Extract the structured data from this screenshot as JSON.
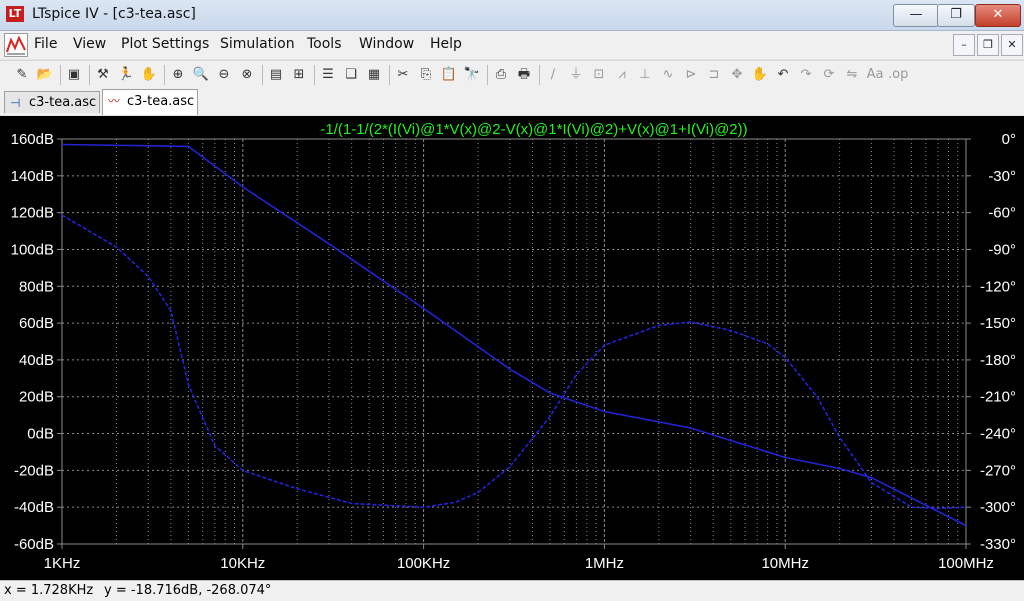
{
  "window": {
    "title": "LTspice IV - [c3-tea.asc]",
    "app_icon_glyph": "LT",
    "buttons": {
      "minimize": "—",
      "restore": "❐",
      "close": "✕"
    }
  },
  "menu": [
    "File",
    "View",
    "Plot Settings",
    "Simulation",
    "Tools",
    "Window",
    "Help"
  ],
  "mdi_buttons": {
    "minimize": "–",
    "restore": "❐",
    "close": "✕"
  },
  "toolbar": [
    {
      "icon": "new-schematic-icon",
      "glyph": "✎",
      "enabled": true
    },
    {
      "icon": "open-icon",
      "glyph": "📂",
      "enabled": true
    },
    {
      "sep": true
    },
    {
      "icon": "save-icon",
      "glyph": "▣",
      "enabled": true
    },
    {
      "sep": true
    },
    {
      "icon": "control-panel-icon",
      "glyph": "⚒",
      "enabled": true
    },
    {
      "icon": "run-icon",
      "glyph": "🏃",
      "enabled": true
    },
    {
      "icon": "pan-icon",
      "glyph": "✋",
      "enabled": false
    },
    {
      "sep": true
    },
    {
      "icon": "zoom-in-icon",
      "glyph": "⊕",
      "enabled": true
    },
    {
      "icon": "zoom-pan-icon",
      "glyph": "🔍",
      "enabled": true
    },
    {
      "icon": "zoom-out-icon",
      "glyph": "⊖",
      "enabled": true
    },
    {
      "icon": "zoom-fit-icon",
      "glyph": "⊗",
      "enabled": true
    },
    {
      "sep": true
    },
    {
      "icon": "autorange-icon",
      "glyph": "▤",
      "enabled": true
    },
    {
      "icon": "fit-icon",
      "glyph": "⊞",
      "enabled": true
    },
    {
      "sep": true
    },
    {
      "icon": "tile-horizontal-icon",
      "glyph": "☰",
      "enabled": true
    },
    {
      "icon": "cascade-icon",
      "glyph": "❏",
      "enabled": true
    },
    {
      "icon": "tile-vertical-icon",
      "glyph": "▦",
      "enabled": true
    },
    {
      "sep": true
    },
    {
      "icon": "cut-icon",
      "glyph": "✂",
      "enabled": true
    },
    {
      "icon": "copy-icon",
      "glyph": "⎘",
      "enabled": true
    },
    {
      "icon": "paste-icon",
      "glyph": "📋",
      "enabled": true
    },
    {
      "icon": "find-icon",
      "glyph": "🔭",
      "enabled": true
    },
    {
      "sep": true
    },
    {
      "icon": "print-preview-icon",
      "glyph": "⎙",
      "enabled": true
    },
    {
      "icon": "print-icon",
      "glyph": "🖶",
      "enabled": true
    },
    {
      "sep": true
    },
    {
      "icon": "wire-icon",
      "glyph": "∕",
      "enabled": false
    },
    {
      "icon": "ground-icon",
      "glyph": "⏚",
      "enabled": false
    },
    {
      "icon": "label-net-icon",
      "glyph": "⊡",
      "enabled": false
    },
    {
      "icon": "resistor-icon",
      "glyph": "⩘",
      "enabled": false
    },
    {
      "icon": "capacitor-icon",
      "glyph": "⊥",
      "enabled": false
    },
    {
      "icon": "inductor-icon",
      "glyph": "∿",
      "enabled": false
    },
    {
      "icon": "diode-icon",
      "glyph": "⊳",
      "enabled": false
    },
    {
      "icon": "component-icon",
      "glyph": "⊐",
      "enabled": false
    },
    {
      "icon": "move-icon",
      "glyph": "✥",
      "enabled": false
    },
    {
      "icon": "drag-icon",
      "glyph": "✋",
      "enabled": false
    },
    {
      "icon": "undo-icon",
      "glyph": "↶",
      "enabled": true
    },
    {
      "icon": "redo-icon",
      "glyph": "↷",
      "enabled": false
    },
    {
      "icon": "rotate-icon",
      "glyph": "⟳",
      "enabled": false
    },
    {
      "icon": "mirror-icon",
      "glyph": "⇋",
      "enabled": false
    },
    {
      "icon": "text-icon",
      "glyph": "Aa",
      "enabled": false
    },
    {
      "icon": "spice-directive-icon",
      "glyph": ".op",
      "enabled": false
    }
  ],
  "tabs": [
    {
      "label": "c3-tea.asc",
      "active": false,
      "icon": "schematic-icon"
    },
    {
      "label": "c3-tea.asc",
      "active": true,
      "icon": "waveform-icon"
    }
  ],
  "status": {
    "x": "x = 1.728KHz",
    "y": "y = -18.716dB, -268.074°"
  },
  "colors": {
    "trace": "#2323d6",
    "expression": "#22ee22",
    "grid": "#8a8a8a",
    "axis_text": "#ffffff"
  },
  "chart_data": {
    "type": "line",
    "title": "-1/(1-1/(2*(I(Vi)@1*V(x)@2-V(x)@1*I(Vi)@2)+V(x)@1+I(Vi)@2))",
    "x_scale": "log",
    "xlim": [
      1000,
      100000000
    ],
    "x_ticks": [
      "1KHz",
      "10KHz",
      "100KHz",
      "1MHz",
      "10MHz",
      "100MHz"
    ],
    "x_tick_values": [
      1000,
      10000,
      100000,
      1000000,
      10000000,
      100000000
    ],
    "ylim_left": [
      -60,
      160
    ],
    "y_ticks_left": [
      "160dB",
      "140dB",
      "120dB",
      "100dB",
      "80dB",
      "60dB",
      "40dB",
      "20dB",
      "0dB",
      "-20dB",
      "-40dB",
      "-60dB"
    ],
    "y_tick_values_left": [
      160,
      140,
      120,
      100,
      80,
      60,
      40,
      20,
      0,
      -20,
      -40,
      -60
    ],
    "ylim_right": [
      -330,
      0
    ],
    "y_ticks_right": [
      "0°",
      "-30°",
      "-60°",
      "-90°",
      "-120°",
      "-150°",
      "-180°",
      "-210°",
      "-240°",
      "-270°",
      "-300°",
      "-330°"
    ],
    "y_tick_values_right": [
      0,
      -30,
      -60,
      -90,
      -120,
      -150,
      -180,
      -210,
      -240,
      -270,
      -300,
      -330
    ],
    "grid": true,
    "series": [
      {
        "axis": "left",
        "style": "solid",
        "x": [
          1000,
          5000,
          10000,
          30000,
          100000,
          300000,
          500000,
          1000000,
          3000000,
          10000000,
          20000000,
          30000000,
          60000000,
          100000000
        ],
        "y": [
          157,
          156,
          134,
          103,
          68,
          35,
          22,
          12,
          3,
          -13,
          -19,
          -24,
          -39,
          -50
        ]
      },
      {
        "axis": "right",
        "style": "dashed",
        "x": [
          1000,
          2000,
          3000,
          4000,
          5000,
          7000,
          10000,
          20000,
          40000,
          100000,
          150000,
          200000,
          300000,
          500000,
          700000,
          1000000,
          2000000,
          3000000,
          5000000,
          8000000,
          10000000,
          15000000,
          20000000,
          30000000,
          50000000,
          70000000,
          100000000
        ],
        "y": [
          -62,
          -88,
          -112,
          -140,
          -200,
          -250,
          -270,
          -285,
          -297,
          -300,
          -296,
          -288,
          -267,
          -226,
          -192,
          -168,
          -152,
          -149,
          -156,
          -167,
          -178,
          -210,
          -243,
          -280,
          -300,
          -301,
          -300
        ]
      }
    ]
  }
}
